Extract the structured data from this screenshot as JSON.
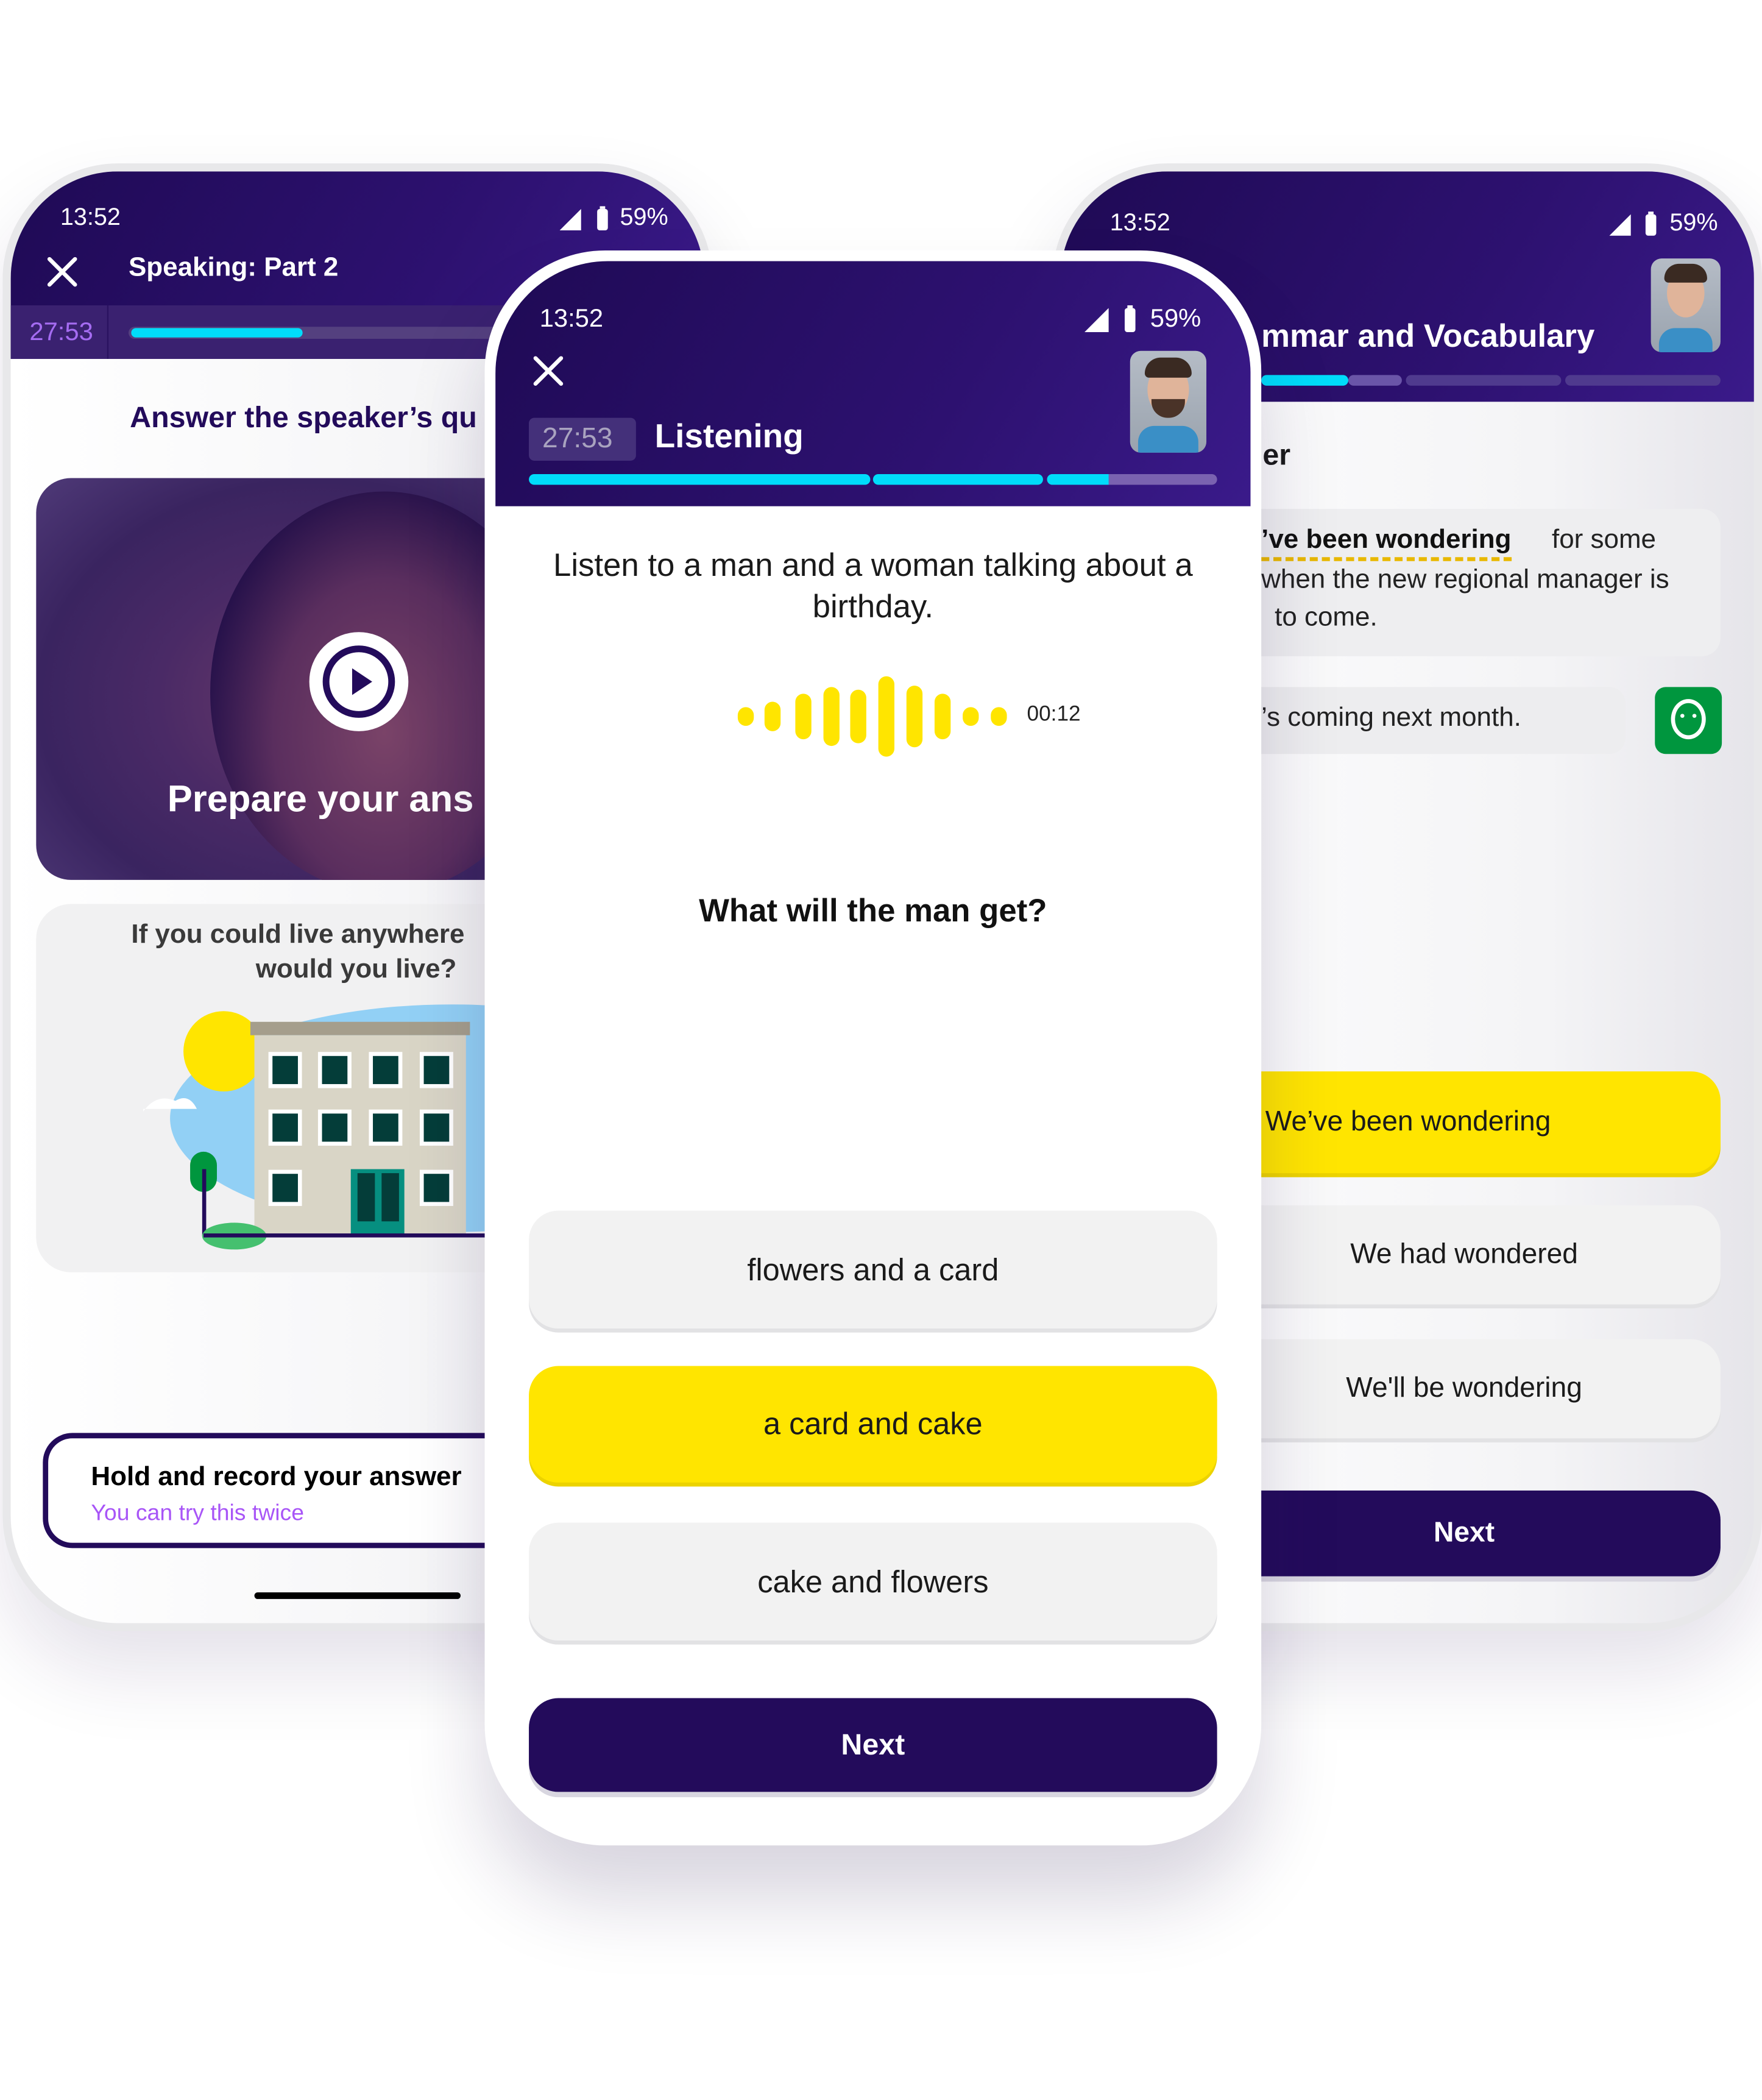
{
  "status": {
    "time": "13:52",
    "battery": "59%"
  },
  "left_phone": {
    "title": "Speaking: Part 2",
    "timer": "27:53",
    "progress": 0.5,
    "instruction": "Answer the speaker’s qu",
    "video_caption": "Prepare your ans",
    "question_line1": "If you could live anywhere",
    "question_line2": "would you live?",
    "record_title": "Hold and record your answer",
    "record_hint": "You can try this twice"
  },
  "center_phone": {
    "title": "Listening",
    "timer": "27:53",
    "instruction": "Listen to a man and a woman talking about a birthday.",
    "audio_time": "00:12",
    "question": "What will the man get?",
    "options": [
      {
        "label": "flowers and a card",
        "selected": false
      },
      {
        "label": "a card and cake",
        "selected": true
      },
      {
        "label": "cake and flowers",
        "selected": false
      }
    ],
    "next_label": "Next"
  },
  "right_phone": {
    "title": "mmar and Vocabulary",
    "heading": "er",
    "prompt_answer": "’ve been wondering",
    "prompt_after": "for some",
    "prompt_line2": "when the new regional manager is",
    "prompt_line3": "to come.",
    "reply": "’s coming next month.",
    "options": [
      {
        "label": "We’ve been wondering",
        "selected": true
      },
      {
        "label": "We had wondered",
        "selected": false
      },
      {
        "label": "We'll be wondering",
        "selected": false
      }
    ],
    "next_label": "Next"
  },
  "colors": {
    "brand_purple": "#230b5b",
    "accent_cyan": "#00dcfa",
    "accent_yellow": "#ffe500",
    "hint_purple": "#a855f7",
    "green": "#00963e"
  }
}
